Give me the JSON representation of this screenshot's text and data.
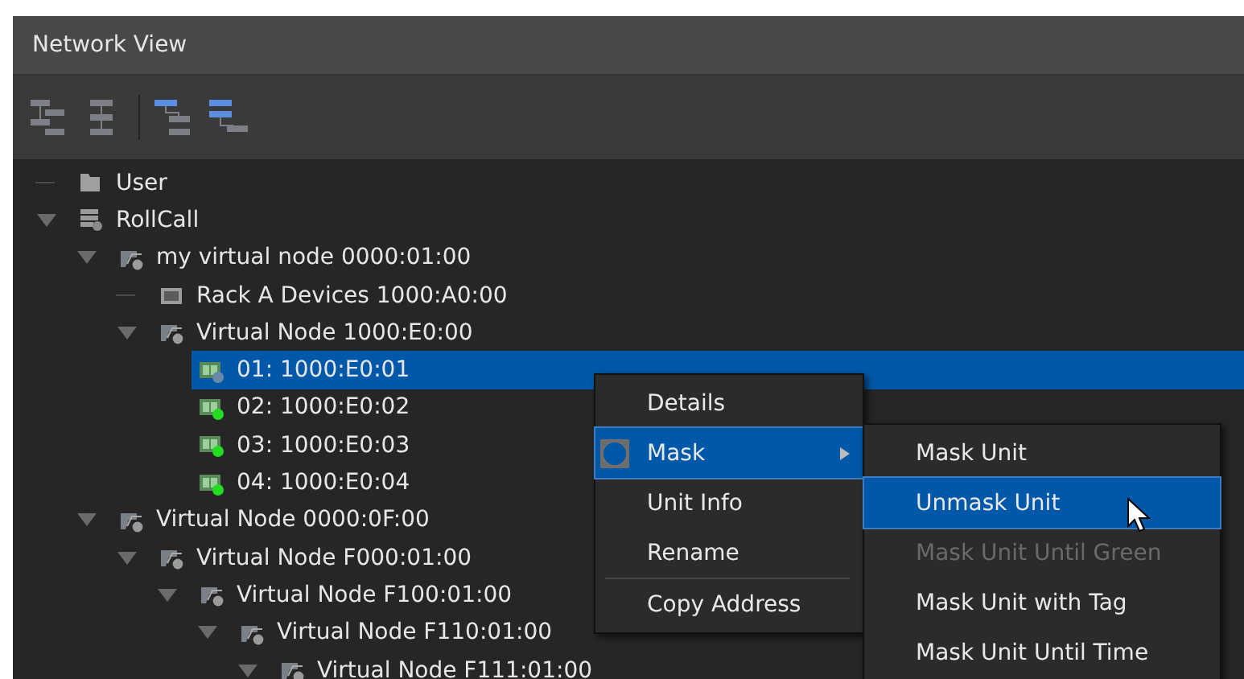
{
  "window": {
    "title": "Network View"
  },
  "toolbar": {
    "buttons": [
      {
        "kind": "tree"
      },
      {
        "kind": "list"
      },
      {
        "kind": "expand"
      },
      {
        "kind": "collapse"
      }
    ]
  },
  "tree": [
    {
      "label": "User",
      "kind": "folder"
    },
    {
      "label": "RollCall",
      "kind": "server",
      "expanded": true,
      "children": [
        {
          "label": "my virtual node 0000:01:00",
          "kind": "vnode",
          "expanded": true,
          "children": [
            {
              "label": "Rack A Devices 1000:A0:00",
              "kind": "rack"
            },
            {
              "label": "Virtual Node 1000:E0:00",
              "kind": "vnode",
              "expanded": true,
              "children": [
                {
                  "label": "01: 1000:E0:01",
                  "kind": "unit",
                  "color": "#6a88a8",
                  "selected": true
                },
                {
                  "label": "02: 1000:E0:02",
                  "kind": "unit",
                  "color": "#22dd22",
                  "selected": false
                },
                {
                  "label": "03: 1000:E0:03",
                  "kind": "unit",
                  "color": "#22dd22",
                  "selected": false
                },
                {
                  "label": "04: 1000:E0:04",
                  "kind": "unit",
                  "color": "#22dd22",
                  "selected": false
                }
              ]
            }
          ]
        },
        {
          "label": "Virtual Node 0000:0F:00",
          "kind": "vnode",
          "expanded": true,
          "children": [
            {
              "label": "Virtual Node F000:01:00",
              "kind": "vnode",
              "expanded": true,
              "children": [
                {
                  "label": "Virtual Node F100:01:00",
                  "kind": "vnode",
                  "expanded": true,
                  "children": [
                    {
                      "label": "Virtual Node F110:01:00",
                      "kind": "vnode",
                      "expanded": true,
                      "children": [
                        {
                          "label": "Virtual Node F111:01:00",
                          "kind": "vnode",
                          "expanded": true
                        }
                      ]
                    }
                  ]
                }
              ]
            }
          ]
        }
      ]
    }
  ],
  "context_menu": {
    "items": [
      {
        "label": "Details",
        "selected": false,
        "separator_before": false
      },
      {
        "label": "Mask",
        "selected": true,
        "submenu": true,
        "separator_before": false
      },
      {
        "label": "Unit Info",
        "selected": false,
        "separator_before": false
      },
      {
        "label": "Rename",
        "selected": false,
        "separator_before": false
      },
      {
        "label": "Copy Address",
        "selected": false,
        "separator_before": true
      }
    ]
  },
  "submenu": {
    "items": [
      {
        "label": "Mask Unit",
        "selected": false,
        "disabled": false
      },
      {
        "label": "Unmask Unit",
        "selected": true,
        "disabled": false
      },
      {
        "label": "Mask Unit Until Green",
        "selected": false,
        "disabled": true
      },
      {
        "label": "Mask Unit with Tag",
        "selected": false,
        "disabled": false
      },
      {
        "label": "Mask Unit Until Time",
        "selected": false,
        "disabled": false
      }
    ]
  }
}
